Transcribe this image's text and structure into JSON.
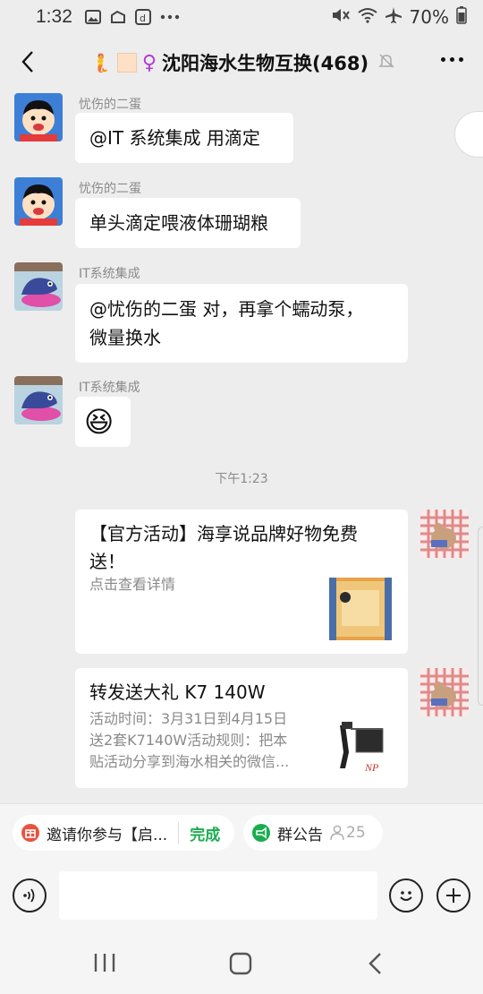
{
  "status": {
    "time": "1:32",
    "battery": "70%"
  },
  "header": {
    "title": "沈阳海水生物互换(468)",
    "female_symbol": "♀",
    "mermaid": "🧜"
  },
  "messages": [
    {
      "sender": "忧伤的二蛋",
      "text": "@IT 系统集成  用滴定"
    },
    {
      "sender": "忧伤的二蛋",
      "text": "单头滴定喂液体珊瑚粮"
    },
    {
      "sender": "IT系统集成",
      "text_line1": "@忧伤的二蛋  对，再拿个蠕动泵，",
      "text_line2": "微量换水"
    },
    {
      "sender": "IT系统集成",
      "emoji": "😆"
    }
  ],
  "timestamp": "下午1:23",
  "cards": [
    {
      "title_line1": "【官方活动】海享说品牌好物免费",
      "title_line2": "送！",
      "desc": "点击查看详情"
    },
    {
      "title": "转发送大礼 K7 140W",
      "desc_line1": "活动时间：3月31日到4月15日",
      "desc_line2": "送2套K7140W活动规则：把本",
      "desc_line3": "贴活动分享到海水相关的微信...",
      "thumb_text": "NP"
    }
  ],
  "chips": {
    "invite_label": "邀请你参与【启...",
    "done_label": "完成",
    "announce_label": "群公告",
    "member_count": "25"
  },
  "colors": {
    "accent_green": "#1aad4f",
    "background": "#ededed",
    "bubble": "#ffffff"
  }
}
